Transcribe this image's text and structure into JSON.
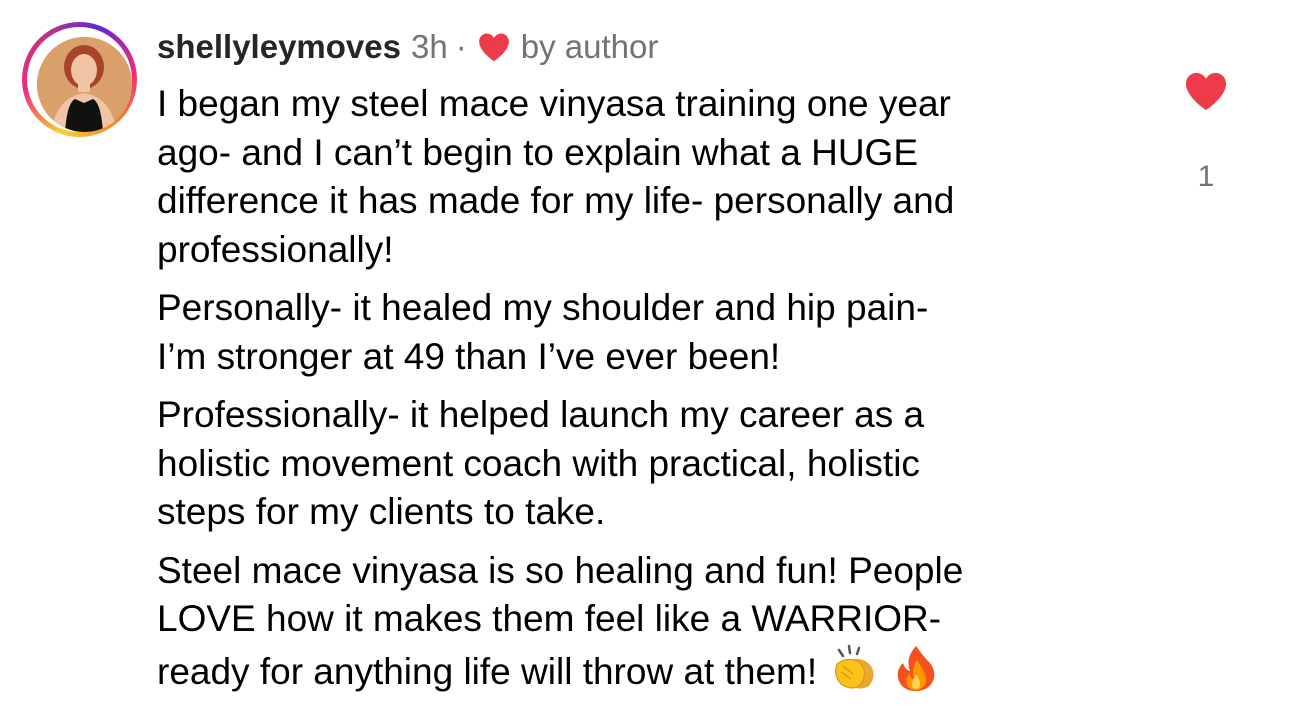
{
  "comment": {
    "username": "shellyleymoves",
    "time": "3h",
    "separator": "·",
    "liked_by_author_label": "by author",
    "paragraphs": [
      "I began my steel mace vinyasa training one year\nago- and I can’t begin to explain what a HUGE\ndifference it has made for my life- personally and\nprofessionally!",
      "Personally- it healed my shoulder and hip pain-\nI’m stronger at 49 than I’ve ever been!",
      "Professionally- it helped launch my career as a\nholistic movement coach with practical, holistic\nsteps for my clients to take.",
      "Steel mace vinyasa is so healing and fun! People\nLOVE how it makes them feel like a WARRIOR-\nready for anything life will throw at them!"
    ],
    "emojis": [
      "clapping-hands-emoji",
      "fire-emoji"
    ],
    "like_count": "1"
  },
  "colors": {
    "heart": "#ed3b4a",
    "meta_gray": "#737373",
    "text": "#000000"
  },
  "icons": {
    "author_like": "heart-icon",
    "like": "heart-icon"
  }
}
